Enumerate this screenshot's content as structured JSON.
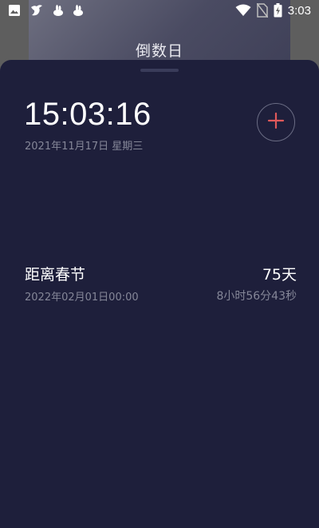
{
  "status_bar": {
    "time": "3:03",
    "left_icons": [
      "image-icon",
      "bird-icon",
      "rabbit-icon",
      "rabbit-icon"
    ],
    "right_icons": [
      "wifi-icon",
      "no-sim-icon",
      "battery-charging-icon"
    ]
  },
  "background_app": {
    "title": "倒数日"
  },
  "clock": {
    "time": "15:03:16",
    "date": "2021年11月17日 星期三"
  },
  "add_button": {
    "icon": "plus-icon",
    "accent_color": "#e0595a"
  },
  "events": [
    {
      "name": "距离春节",
      "target_datetime": "2022年02月01日00:00",
      "days": "75天",
      "remaining": "8小时56分43秒"
    }
  ],
  "colors": {
    "sheet_background": "#1e1f3b",
    "primary_text": "#ffffff",
    "secondary_text": "#858798"
  }
}
